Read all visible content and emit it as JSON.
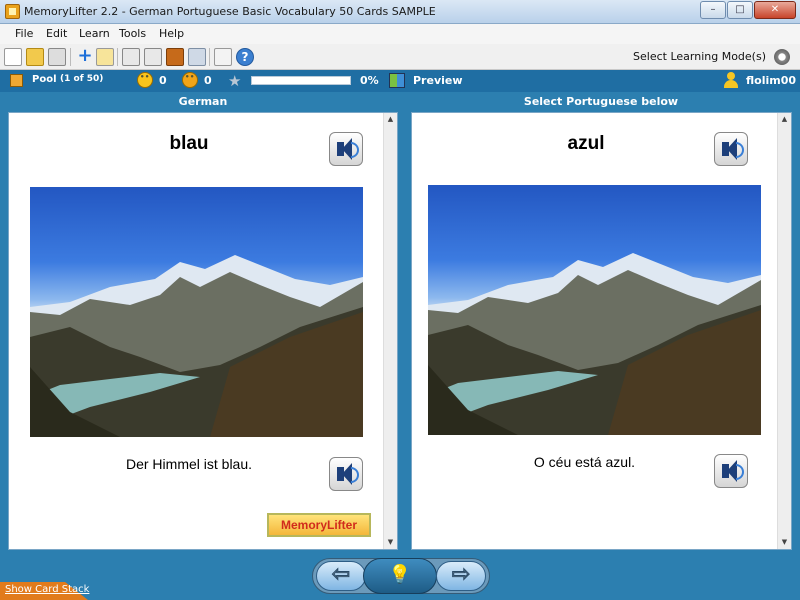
{
  "window": {
    "title": "MemoryLifter 2.2 - German Portuguese Basic Vocabulary 50 Cards SAMPLE",
    "controls": {
      "minimize": "–",
      "maximize": "□",
      "close": "✕"
    }
  },
  "menu": [
    "File",
    "Edit",
    "Learn",
    "Tools",
    "Help"
  ],
  "toolbar": {
    "icons": [
      "new-document-icon",
      "open-folder-icon",
      "print-icon",
      "add-card-icon",
      "edit-card-icon",
      "presentation-icon",
      "stop-icon",
      "book-icon",
      "tools-icon",
      "lock-icon",
      "help-icon"
    ],
    "add_glyph": "+",
    "help_glyph": "?",
    "learning_mode_label": "Select Learning Mode(s)"
  },
  "status": {
    "pool_label": "Pool",
    "pool_count": "(1 of 50)",
    "good_count": "0",
    "bad_count": "0",
    "star_glyph": "★",
    "progress_percent": 0,
    "progress_label": "0%",
    "preview_label": "Preview",
    "user_name": "flolim00"
  },
  "columns": {
    "left_header": "German",
    "right_header": "Select Portuguese below"
  },
  "cards": {
    "left": {
      "word": "blau",
      "sentence": "Der Himmel ist blau."
    },
    "right": {
      "word": "azul",
      "sentence": "O céu está azul."
    }
  },
  "logo_text": "MemoryLifter",
  "scroll": {
    "up": "▲",
    "down": "▼"
  },
  "nav": {
    "prev_glyph": "⇦",
    "next_glyph": "⇨",
    "hint_glyph": "💡"
  },
  "bottom": {
    "show_stack_label": "Show Card Stack"
  },
  "colors": {
    "accent": "#2c7fb0",
    "status_bar": "#1f6ea3",
    "stack_tab": "#e17b1c"
  }
}
